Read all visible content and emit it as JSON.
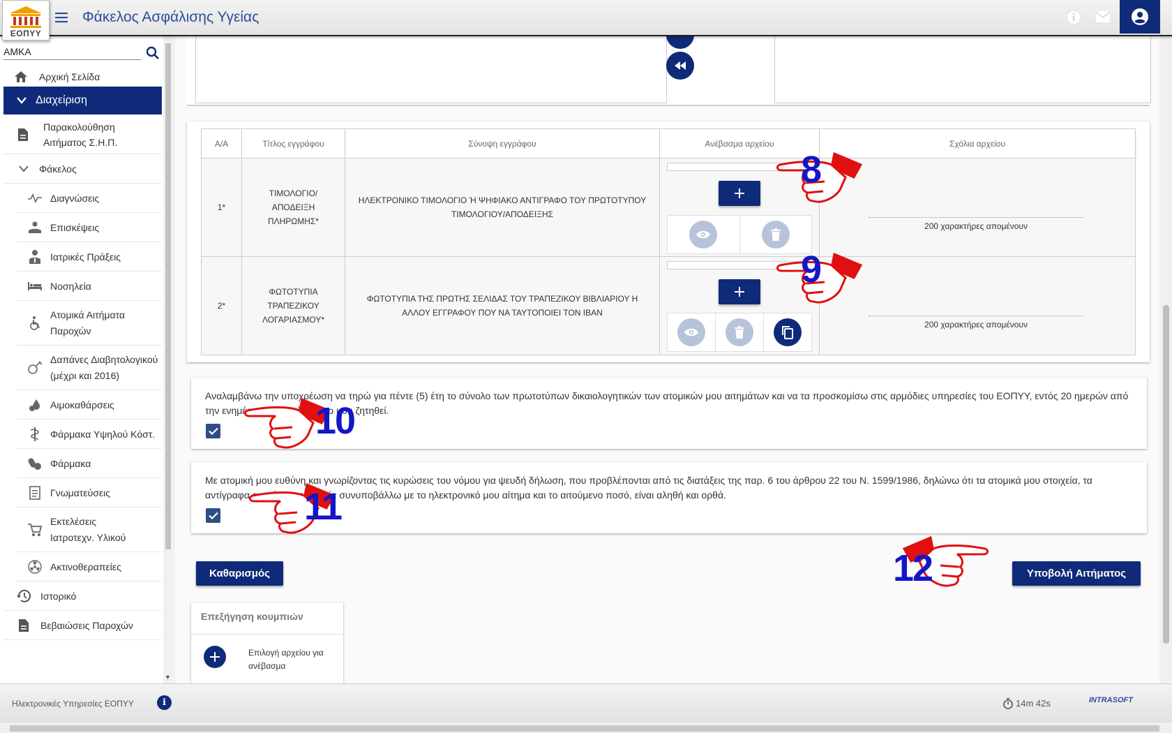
{
  "header": {
    "title": "Φάκελος Ασφάλισης Υγείας",
    "logo_text": "ΕΟΠΥΥ"
  },
  "sidebar": {
    "amka_value": "ΑΜΚΑ",
    "items": [
      {
        "label": "Αρχική Σελίδα",
        "icon": "home-icon"
      },
      {
        "label": "Διαχείριση",
        "icon": "chevron-down-icon"
      },
      {
        "label": "Παρακολούθηση Αιτήματος Σ.Η.Π.",
        "icon": "document-icon"
      },
      {
        "label": "Φάκελος",
        "icon": "chevron-down-icon"
      },
      {
        "label": "Διαγνώσεις",
        "icon": "pulse-icon"
      },
      {
        "label": "Επισκέψεις",
        "icon": "doctor-hand-icon"
      },
      {
        "label": "Ιατρικές Πράξεις",
        "icon": "doctor-icon"
      },
      {
        "label": "Νοσηλεία",
        "icon": "bed-icon"
      },
      {
        "label": "Ατομικά Αιτήματα Παροχών",
        "icon": "wheelchair-icon"
      },
      {
        "label": "Δαπάνες Διαβητολογικού (μέχρι και 2016)",
        "icon": "syringe-icon"
      },
      {
        "label": "Αιμοκαθάρσεις",
        "icon": "blood-icon"
      },
      {
        "label": "Φάρμακα Υψηλού Κόστ.",
        "icon": "pharmacy-icon"
      },
      {
        "label": "Φάρμακα",
        "icon": "pills-icon"
      },
      {
        "label": "Γνωματεύσεις",
        "icon": "notes-icon"
      },
      {
        "label": "Εκτελέσεις Ιατροτεχν. Υλικού",
        "icon": "cart-icon"
      },
      {
        "label": "Ακτινοθεραπείες",
        "icon": "radiation-icon"
      },
      {
        "label": "Ιστορικό",
        "icon": "history-icon"
      },
      {
        "label": "Βεβαιώσεις Παροχών",
        "icon": "document-icon"
      }
    ]
  },
  "table": {
    "headers": [
      "Α/Α",
      "Τίτλος εγγράφου",
      "Σύνοψη εγγράφου",
      "Ανέβασμα αρχείου",
      "Σχόλια αρχείου"
    ],
    "rows": [
      {
        "num": "1*",
        "title": "ΤΙΜΟΛΟΓΙΟ/ ΑΠΟΔΕΙΞΗ ΠΛΗΡΩΜΗΣ*",
        "summary": "ΗΛΕΚΤΡΟΝΙΚΟ ΤΙΜΟΛΟΓΙΟ Ή ΨΗΦΙΑΚΟ ΑΝΤΙΓΡΑΦΟ ΤΟΥ ΠΡΩΤΟΤΥΠΟΥ ΤΙΜΟΛΟΓΙΟΥ/ΑΠΟΔΕΙΞΗΣ",
        "comment": "200 χαρακτήρες απομένουν"
      },
      {
        "num": "2*",
        "title": "ΦΩΤΟΤΥΠΙΑ ΤΡΑΠΕΖΙΚΟΥ ΛΟΓΑΡΙΑΣΜΟΥ*",
        "summary": "ΦΩΤΟΤΥΠΙΑ ΤΗΣ ΠΡΩΤΗΣ ΣΕΛΙΔΑΣ ΤΟΥ ΤΡΑΠΕΖΙΚΟΥ ΒΙΒΛΙΑΡΙΟΥ Η ΑΛΛΟΥ ΕΓΓΡΑΦΟΥ ΠΟΥ ΝΑ ΤΑΥΤΟΠΟΙΕΙ ΤΟΝ IBAN",
        "comment": "200 χαρακτήρες απομένουν"
      }
    ]
  },
  "declarations": [
    {
      "text": "Αναλαμβάνω την υποχρέωση να τηρώ για πέντε (5) έτη το σύνολο των πρωτοτύπων δικαιολογητικών των ατομικών μου αιτημάτων και να τα προσκομίσω στις αρμόδιες υπηρεσίες του ΕΟΠΥΥ, εντός 20 ημερών από την ενημέρωσή μου, ότι τούτο μου ζητηθεί.",
      "checked": true
    },
    {
      "text": "Με ατομική μου ευθύνη και γνωρίζοντας τις κυρώσεις του νόμου για ψευδή δήλωση, που προβλέπονται από τις διατάξεις της παρ. 6 του άρθρου 22 του Ν. 1599/1986, δηλώνω ότι τα ατομικά μου στοιχεία, τα αντίγραφα εγγράφων τα οποία συνυποβάλλω με το ηλεκτρονικό μου αίτημα και το αιτούμενο ποσό, είναι αληθή και ορθά.",
      "checked": true
    }
  ],
  "buttons": {
    "clear": "Καθαρισμός",
    "submit": "Υποβολή Αιτήματος"
  },
  "legend": {
    "title": "Επεξήγηση κουμπιών",
    "item_add": "Επιλογή αρχείου για ανέβασμα"
  },
  "annotations": [
    "8",
    "9",
    "10",
    "11",
    "12"
  ],
  "status": {
    "left_text": "Ηλεκτρονικές Υπηρεσίες ΕΟΠΥΥ",
    "timer": "14m 42s",
    "vendor": "INTRASOFT"
  },
  "colors": {
    "primary": "#0f2a78",
    "title": "#2b4f9a",
    "annotation_hand": "#e01010",
    "annotation_number": "#1515c8"
  }
}
